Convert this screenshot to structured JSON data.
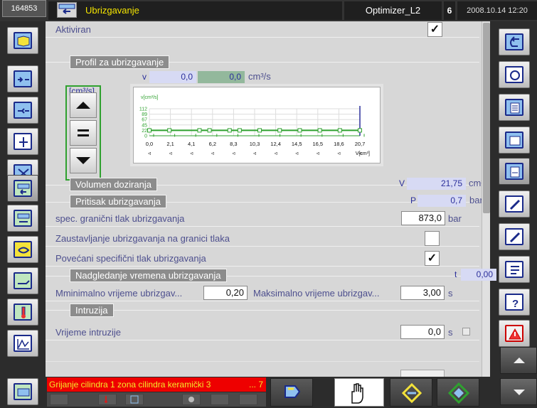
{
  "topbar": {
    "machine_id": "164853",
    "title": "Ubrizgavanje",
    "program": "Optimizer_L2",
    "number": "6",
    "datetime": "2008.10.14 12:20"
  },
  "left_tools": [
    "mold-icon",
    "clamp-open-icon",
    "clamp-close-icon",
    "ejector-icon",
    "core-icon",
    "injection-icon",
    "holding-icon",
    "plasticizing-icon",
    "nozzle-icon",
    "temperature-icon",
    "graph-icon",
    "machine-home-icon"
  ],
  "right_tools": [
    "back-icon",
    "monitoring-icon",
    "statistics-icon",
    "production-icon",
    "document-icon",
    "edit-icon",
    "edit2-icon",
    "notes-icon",
    "help-icon",
    "alarm-icon"
  ],
  "content": {
    "activated_label": "Aktiviran",
    "activated_check": "✓",
    "profile_section": "Profil za ubrizgavanje",
    "v_label": "v",
    "v_value1": "0,0",
    "v_value2": "0,0",
    "v_unit": "cm³/s",
    "speed_unit": "[cm³/s]",
    "chart": {
      "ylabel": "v[cm³/s]",
      "xlabel": "V[cm³]",
      "yticks": [
        "112",
        "89",
        "67",
        "45",
        "22",
        "0"
      ],
      "xticks": [
        "0,0",
        "2,1",
        "4,1",
        "6,2",
        "8,3",
        "10,3",
        "12,4",
        "14,5",
        "16,5",
        "18,6",
        "20,7"
      ]
    },
    "dosing_section": "Volumen doziranja",
    "dosing_var": "V",
    "dosing_value": "21,75",
    "dosing_unit": "cm³",
    "pressure_section": "Pritisak ubrizgavanja",
    "pressure_var": "P",
    "pressure_value": "0,7",
    "pressure_unit": "bar",
    "spec_pressure_label": "spec. granični tlak ubrizgavanja",
    "spec_pressure_value": "873,0",
    "spec_pressure_unit": "bar",
    "stop_label": "Zaustavljanje ubrizgavanja na granici tlaka",
    "stop_check": "",
    "increased_label": "Povećani specifični tlak ubrizgavanja",
    "increased_check": "✓",
    "time_section": "Nadgledanje vremena ubrizgavanja",
    "time_var": "t",
    "time_value": "0,00",
    "time_unit": "s",
    "min_time_label": "Mminimalno vrijeme ubrizgav...",
    "min_time_value": "0,20",
    "max_time_label": "Maksimalno vrijeme ubrizgav...",
    "max_time_value": "3,00",
    "max_time_unit": "s",
    "intrusion_section": "Intruzija",
    "intrusion_time_label": "Vrijeme intruzije",
    "intrusion_time_value": "0,0",
    "intrusion_time_unit": "s"
  },
  "alarm": {
    "text": "Grijanje cilindra 1 zona cilindra keramički 3",
    "count": "... 7"
  },
  "colors": {
    "title_yellow": "#f5e500",
    "label_blue": "#4d4f8e",
    "alarm_red": "#e00000",
    "chart_green": "#2fa12f",
    "readout_bg": "#d7daf4"
  }
}
